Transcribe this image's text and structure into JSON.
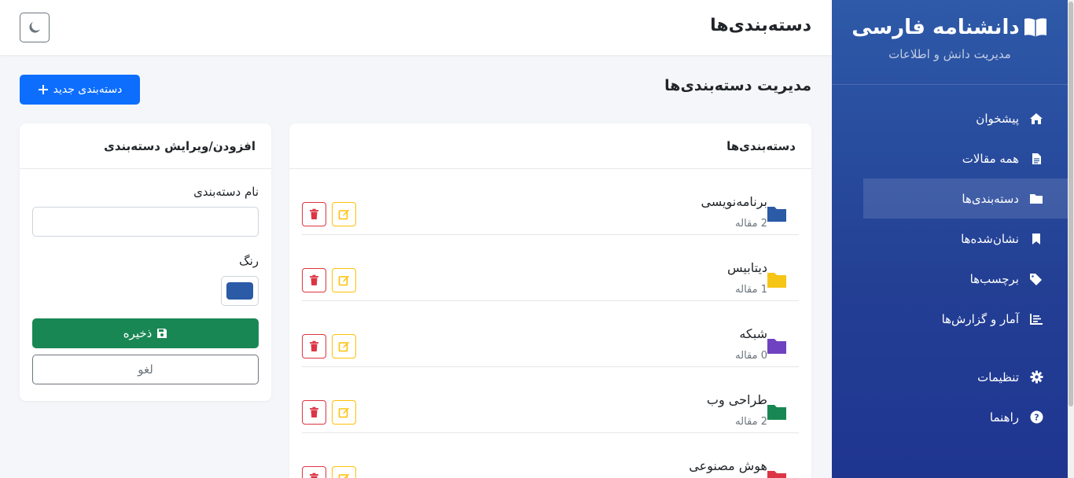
{
  "brand": {
    "title": "دانشنامه فارسی",
    "subtitle": "مدیریت دانش و اطلاعات",
    "icon": "book-open-icon"
  },
  "nav": [
    {
      "label": "پیشخوان",
      "icon": "home-icon"
    },
    {
      "label": "همه مقالات",
      "icon": "file-icon"
    },
    {
      "label": "دسته‌بندی‌ها",
      "icon": "folder-icon",
      "active": true
    },
    {
      "label": "نشان‌شده‌ها",
      "icon": "bookmark-icon"
    },
    {
      "label": "برچسب‌ها",
      "icon": "tags-icon"
    },
    {
      "label": "آمار و گزارش‌ها",
      "icon": "chart-icon"
    }
  ],
  "nav_bottom": [
    {
      "label": "تنظیمات",
      "icon": "gear-icon"
    },
    {
      "label": "راهنما",
      "icon": "question-icon"
    }
  ],
  "header": {
    "title": "دسته‌بندی‌ها",
    "theme_icon": "moon-icon"
  },
  "main": {
    "section_title": "مدیریت دسته‌بندی‌ها",
    "new_button": "دسته‌بندی جدید",
    "list_title": "دسته‌بندی‌ها",
    "categories": [
      {
        "name": "برنامه‌نویسی",
        "count": "2 مقاله",
        "color": "#2b5aa6"
      },
      {
        "name": "دیتابیس",
        "count": "1 مقاله",
        "color": "#f5c518"
      },
      {
        "name": "شبکه",
        "count": "0 مقاله",
        "color": "#6f42c1"
      },
      {
        "name": "طراحی وب",
        "count": "2 مقاله",
        "color": "#198754"
      },
      {
        "name": "هوش مصنوعی",
        "count": "",
        "color": "#dc3545"
      }
    ]
  },
  "form": {
    "title": "افزودن/ویرایش دسته‌بندی",
    "name_label": "نام دسته‌بندی",
    "name_value": "",
    "color_label": "رنگ",
    "color_value": "#2b5aa6",
    "save_label": "ذخیره",
    "cancel_label": "لغو"
  },
  "colors": {
    "accent": "#0d6efd",
    "success": "#198754",
    "danger": "#dc3545",
    "warning": "#ffc107"
  }
}
